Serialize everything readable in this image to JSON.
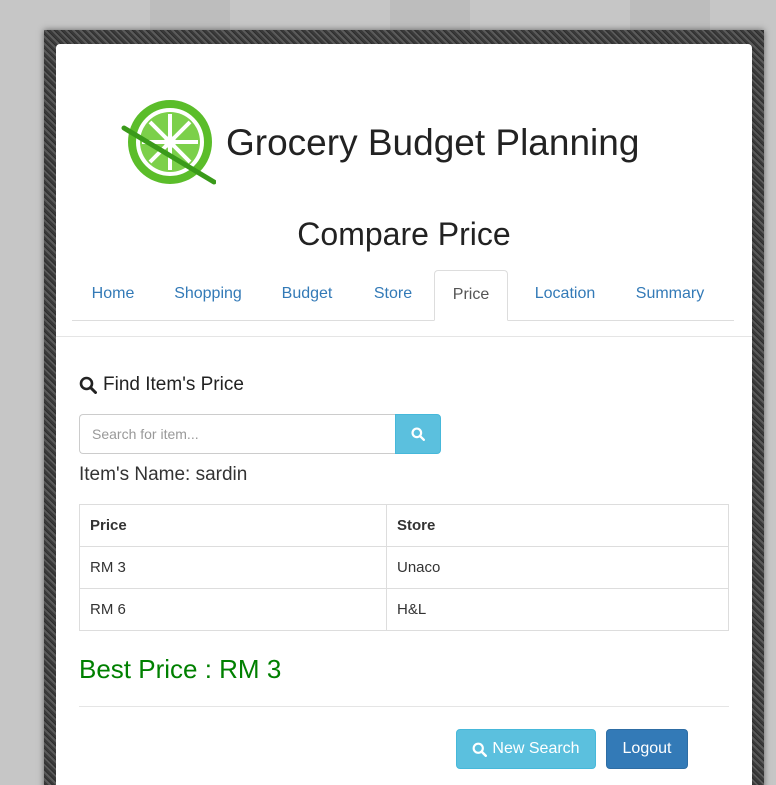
{
  "app": {
    "title": "Grocery Budget Planning",
    "logo_icon": "lime-slice-logo-icon",
    "accent_color": "#5bbd2a"
  },
  "page": {
    "title": "Compare Price"
  },
  "tabs": [
    {
      "label": "Home",
      "active": false
    },
    {
      "label": "Shopping",
      "active": false
    },
    {
      "label": "Budget",
      "active": false
    },
    {
      "label": "Store",
      "active": false
    },
    {
      "label": "Price",
      "active": true
    },
    {
      "label": "Location",
      "active": false
    },
    {
      "label": "Summary",
      "active": false
    }
  ],
  "search": {
    "heading": "Find Item's Price",
    "heading_icon": "search-icon",
    "placeholder": "Search for item...",
    "value": "",
    "button_icon": "search-icon"
  },
  "result": {
    "item_name_text": "Item's Name: sardin",
    "columns": [
      "Price",
      "Store"
    ],
    "rows": [
      [
        "RM 3",
        "Unaco"
      ],
      [
        "RM 6",
        "H&L"
      ]
    ],
    "best_price_text": "Best Price : RM 3",
    "best_price_color": "#008000"
  },
  "actions": {
    "new_search_label": "New Search",
    "logout_label": "Logout"
  }
}
